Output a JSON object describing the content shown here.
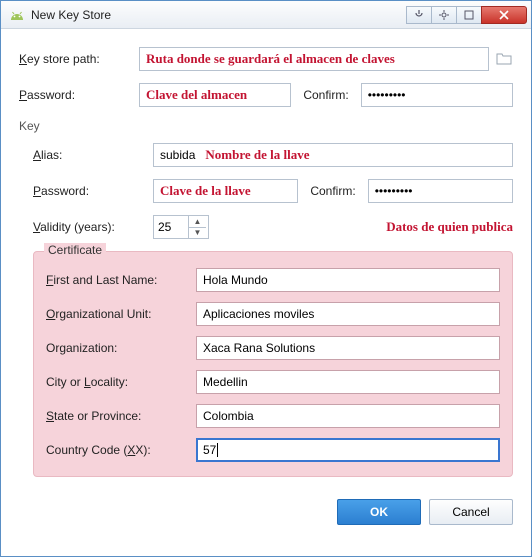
{
  "window": {
    "title": "New Key Store"
  },
  "keystore": {
    "path_label_pre": "K",
    "path_label_post": "ey store path:",
    "path_anno": "Ruta donde se guardará el almacen de claves",
    "pwd_label_pre": "P",
    "pwd_label_post": "assword:",
    "pwd_anno": "Clave del almacen",
    "confirm_label_pre": "C",
    "confirm_label_post": "onfirm:",
    "confirm_value": "•••••••••"
  },
  "key_section_label": "Key",
  "key": {
    "alias_label_pre": "A",
    "alias_label_post": "lias:",
    "alias_value": "subida",
    "alias_anno": "Nombre de la llave",
    "pwd_label_pre": "P",
    "pwd_label_post": "assword:",
    "pwd_anno": "Clave de la llave",
    "confirm_label_pre": "C",
    "confirm_label_post": "onfirm:",
    "confirm_value": "•••••••••",
    "validity_label_pre": "V",
    "validity_label_post": "alidity (years):",
    "validity_value": "25",
    "publisher_anno": "Datos de quien publica"
  },
  "cert": {
    "legend": "Certificate",
    "rows": [
      {
        "label_pre": "F",
        "label_post": "irst and Last Name:",
        "value": "Hola Mundo"
      },
      {
        "label_pre": "O",
        "label_post": "rganizational Unit:",
        "value": "Aplicaciones moviles"
      },
      {
        "label_pre": "",
        "label_post": "Organization:",
        "value": "Xaca Rana Solutions",
        "no_u": true
      },
      {
        "label_pre": "",
        "label_post": "City or ",
        "label_u": "L",
        "label_tail": "ocality:",
        "value": "Medellin"
      },
      {
        "label_pre": "S",
        "label_post": "tate or Province:",
        "value": "Colombia"
      },
      {
        "label_pre": "",
        "label_post": "Country Code (",
        "label_u": "X",
        "label_tail": "X):",
        "value": "57",
        "focus": true
      }
    ]
  },
  "buttons": {
    "ok": "OK",
    "cancel": "Cancel"
  }
}
